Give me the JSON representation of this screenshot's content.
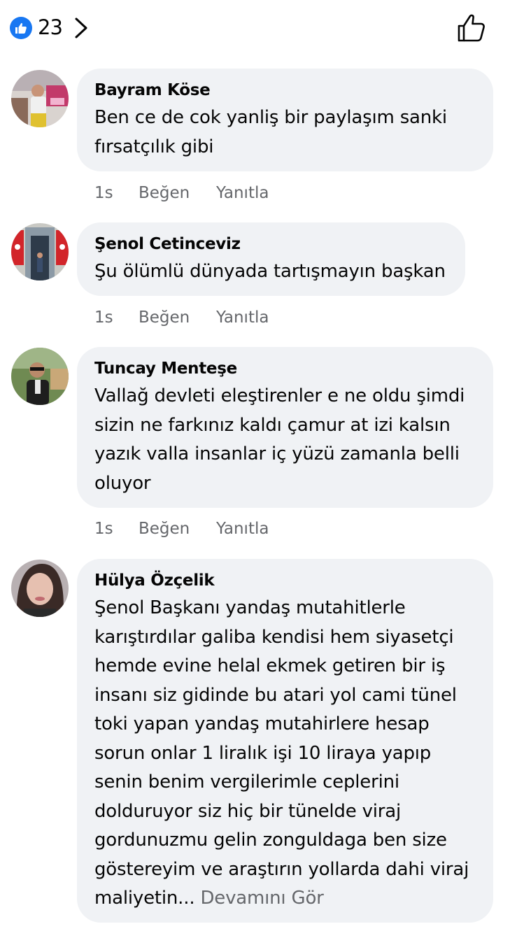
{
  "header": {
    "reaction_count": "23",
    "colors": {
      "like_blue": "#1877f2"
    }
  },
  "comments": [
    {
      "author": "Bayram Köse",
      "text": "Ben ce de cok yanliş bir paylaşım sanki fırsatçılık gibi",
      "time": "1s",
      "like_label": "Beğen",
      "reply_label": "Yanıtla"
    },
    {
      "author": "Şenol Cetinceviz",
      "text": "Şu ölümlü dünyada  tartışmayın başkan",
      "time": "1s",
      "like_label": "Beğen",
      "reply_label": "Yanıtla"
    },
    {
      "author": "Tuncay Menteşe",
      "text": "Vallağ devleti eleştirenler e ne oldu şimdi sizin ne farkınız kaldı çamur at izi kalsın yazık valla insanlar iç yüzü zamanla belli oluyor",
      "time": "1s",
      "like_label": "Beğen",
      "reply_label": "Yanıtla"
    },
    {
      "author": "Hülya Özçelik",
      "text": "Şenol Başkanı yandaş mutahitlerle karıştırdılar  galiba kendisi hem siyasetçi hemde evine helal ekmek getiren bir iş insanı siz gidinde bu atari yol cami tünel toki yapan yandaş mutahirlere hesap sorun onlar 1 liralık işi 10 liraya yapıp senin benim vergilerimle ceplerini dolduruyor siz hiç bir tünelde viraj gordunuzmu gelin zonguldaga ben size göstereyim ve araştırın yollarda dahi viraj maliyetin...",
      "see_more": " Devamını Gör"
    }
  ],
  "icons": {
    "reaction": "thumbs-up-filled-icon",
    "expand": "chevron-right-icon",
    "like": "thumbs-up-outline-icon"
  }
}
